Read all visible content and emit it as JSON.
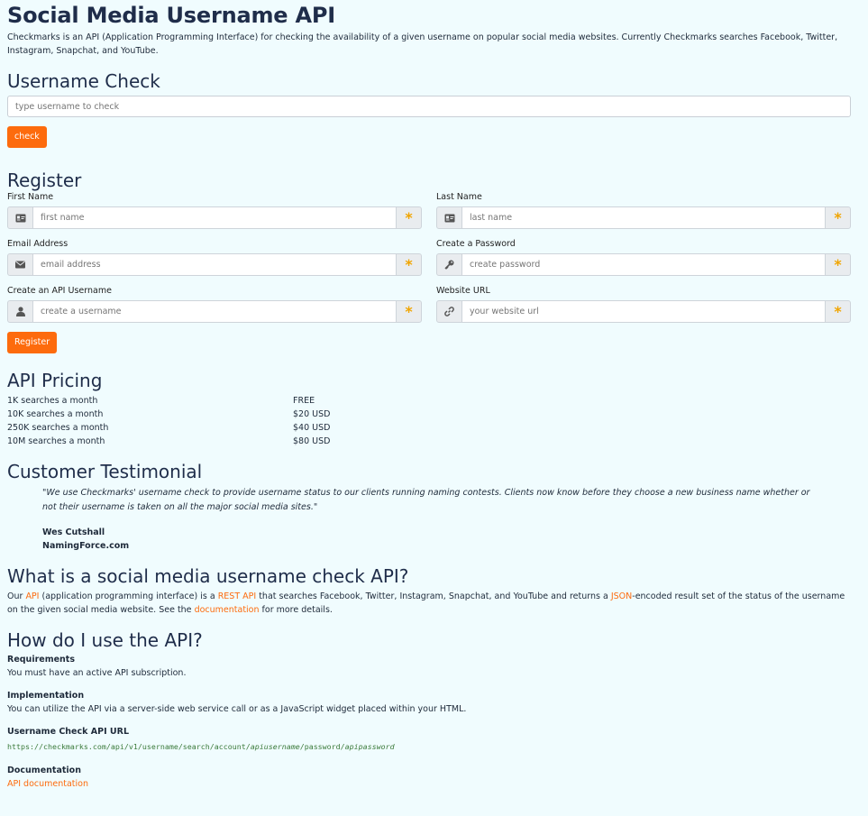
{
  "title": "Social Media Username API",
  "intro": "Checkmarks is an API (Application Programming Interface) for checking the availability of a given username on popular social media websites. Currently Checkmarks searches Facebook, Twitter, Instagram, Snapchat, and YouTube.",
  "username_check": {
    "heading": "Username Check",
    "placeholder": "type username to check",
    "button": "check"
  },
  "register": {
    "heading": "Register",
    "required_mark": "*",
    "fields": {
      "first_name": {
        "label": "First Name",
        "placeholder": "first name",
        "icon": "id-card-icon"
      },
      "last_name": {
        "label": "Last Name",
        "placeholder": "last name",
        "icon": "id-card-icon"
      },
      "email": {
        "label": "Email Address",
        "placeholder": "email address",
        "icon": "envelope-icon"
      },
      "password": {
        "label": "Create a Password",
        "placeholder": "create password",
        "icon": "key-icon"
      },
      "api_username": {
        "label": "Create an API Username",
        "placeholder": "create a username",
        "icon": "user-icon"
      },
      "website": {
        "label": "Website URL",
        "placeholder": "your website url",
        "icon": "link-icon"
      }
    },
    "button": "Register"
  },
  "pricing": {
    "heading": "API Pricing",
    "rows": [
      {
        "tier": "1K searches a month",
        "price": "FREE"
      },
      {
        "tier": "10K searches a month",
        "price": "$20 USD"
      },
      {
        "tier": "250K searches a month",
        "price": "$40 USD"
      },
      {
        "tier": "10M searches a month",
        "price": "$80 USD"
      }
    ]
  },
  "testimonial": {
    "heading": "Customer Testimonial",
    "quote": "\"We use Checkmarks' username check to provide username status to our clients running naming contests. Clients now know before they choose a new business name whether or not their username is taken on all the major social media sites.\"",
    "author": "Wes Cutshall",
    "company": "NamingForce.com"
  },
  "what": {
    "heading": "What is a social media username check API?",
    "t1": "Our ",
    "link_api": "API",
    "t2": " (application programming interface) is a ",
    "link_rest": "REST API",
    "t3": " that searches Facebook, Twitter, Instagram, Snapchat, and YouTube and returns a ",
    "link_json": "JSON",
    "t4": "-encoded result set of the status of the username on the given social media website. See the ",
    "link_docs": "documentation",
    "t5": " for more details."
  },
  "how": {
    "heading": "How do I use the API?",
    "requirements_title": "Requirements",
    "requirements_text": "You must have an active API subscription.",
    "implementation_title": "Implementation",
    "implementation_text": "You can utilize the API via a server-side web service call or as a JavaScript widget placed within your HTML.",
    "url_title": "Username Check API URL",
    "url_base": "https://checkmarks.com/api/v1/username/search/account/",
    "url_user": "apiusername",
    "url_sep": "/password/",
    "url_pass": "apipassword",
    "docs_title": "Documentation",
    "docs_link": "API documentation"
  },
  "colors": {
    "accent": "#fd6b0d",
    "background": "#f0fcfe",
    "heading": "#1f2d4a",
    "required": "#f0a500"
  }
}
